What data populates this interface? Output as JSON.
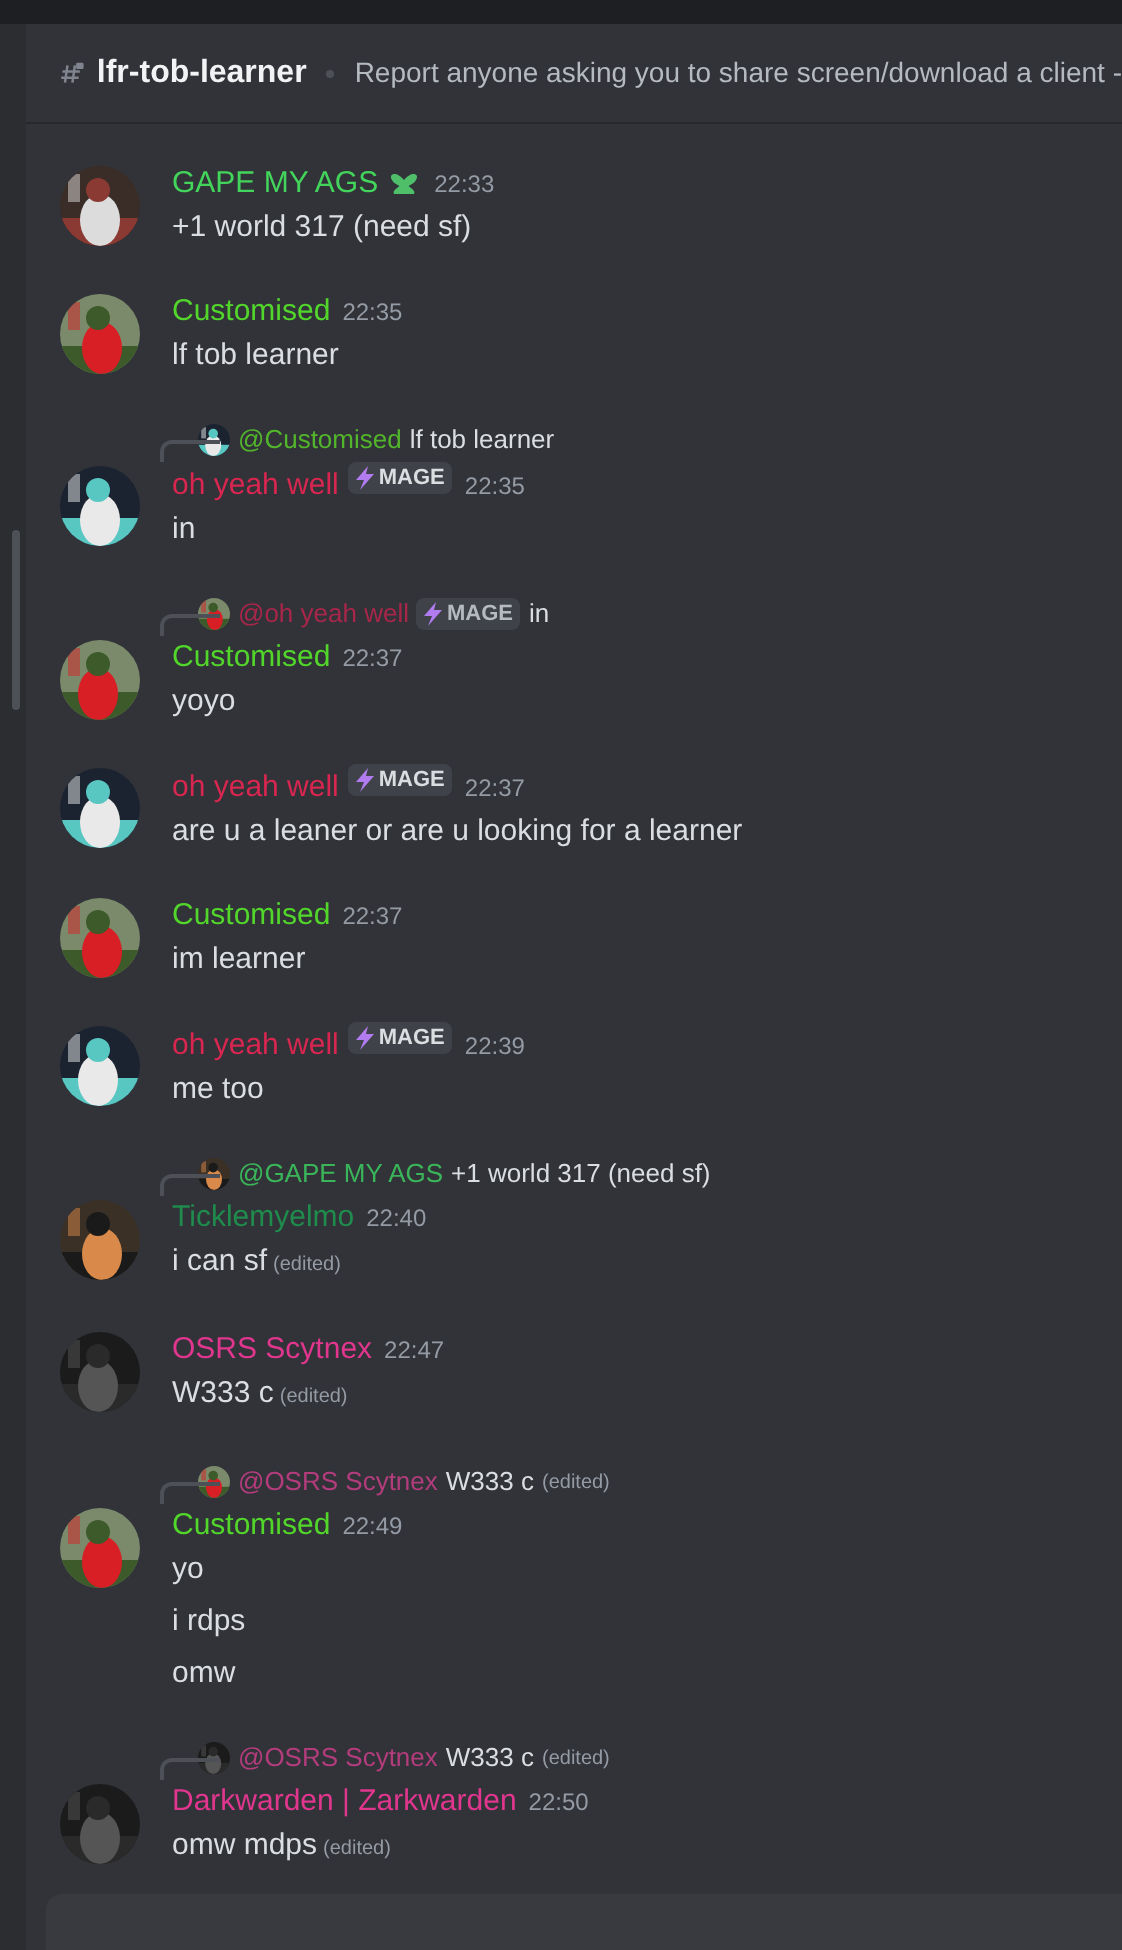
{
  "header": {
    "channel": "lfr-tob-learner",
    "topic": "Report anyone asking you to share screen/download a client -"
  },
  "messages": [
    {
      "author": "GAPE MY AGS",
      "color": "#43d45b",
      "role_icon": true,
      "time": "22:33",
      "lines": [
        {
          "text": "+1 world 317 (need sf)"
        }
      ]
    },
    {
      "author": "Customised",
      "color": "#52d62b",
      "time": "22:35",
      "lines": [
        {
          "text": "lf tob learner"
        }
      ]
    },
    {
      "reply": {
        "author": "@Customised",
        "color": "#52b52b",
        "text": "lf tob learner"
      },
      "author": "oh yeah well",
      "color": "#d7264f",
      "badge": "MAGE",
      "time": "22:35",
      "lines": [
        {
          "text": "in"
        }
      ]
    },
    {
      "reply": {
        "author": "@oh yeah well",
        "color": "#a8264a",
        "badge": "MAGE",
        "text": "in"
      },
      "author": "Customised",
      "color": "#52d62b",
      "time": "22:37",
      "lines": [
        {
          "text": "yoyo"
        }
      ]
    },
    {
      "author": "oh yeah well",
      "color": "#d7264f",
      "badge": "MAGE",
      "time": "22:37",
      "lines": [
        {
          "text": "are u a leaner or are u looking for a learner"
        }
      ]
    },
    {
      "author": "Customised",
      "color": "#52d62b",
      "time": "22:37",
      "lines": [
        {
          "text": "im learner"
        }
      ]
    },
    {
      "author": "oh yeah well",
      "color": "#d7264f",
      "badge": "MAGE",
      "time": "22:39",
      "lines": [
        {
          "text": "me too"
        }
      ]
    },
    {
      "reply": {
        "author": "@GAPE MY AGS",
        "color": "#3bb55a",
        "text": "+1 world 317 (need sf)"
      },
      "author": "Ticklemyelmo",
      "color": "#1f8b4c",
      "time": "22:40",
      "lines": [
        {
          "text": "i  can sf",
          "edited_label": "(edited)"
        }
      ]
    },
    {
      "author": "OSRS Scytnex",
      "color": "#e0368e",
      "time": "22:47",
      "lines": [
        {
          "text": "W333 c",
          "edited_label": "(edited)"
        }
      ]
    },
    {
      "reply": {
        "author": "@OSRS Scytnex",
        "color": "#b23c7c",
        "text": "W333 c",
        "edited_label": "(edited)"
      },
      "author": "Customised",
      "color": "#52d62b",
      "time": "22:49",
      "lines": [
        {
          "text": "yo"
        },
        {
          "text": "i rdps"
        },
        {
          "text": "omw"
        }
      ]
    },
    {
      "reply": {
        "author": "@OSRS Scytnex",
        "color": "#b23c7c",
        "text": "W333 c",
        "edited_label": "(edited)"
      },
      "author": "Darkwarden | Zarkwarden",
      "color": "#e0368e",
      "time": "22:50",
      "lines": [
        {
          "text": "omw mdps",
          "edited_label": "(edited)"
        }
      ]
    }
  ]
}
